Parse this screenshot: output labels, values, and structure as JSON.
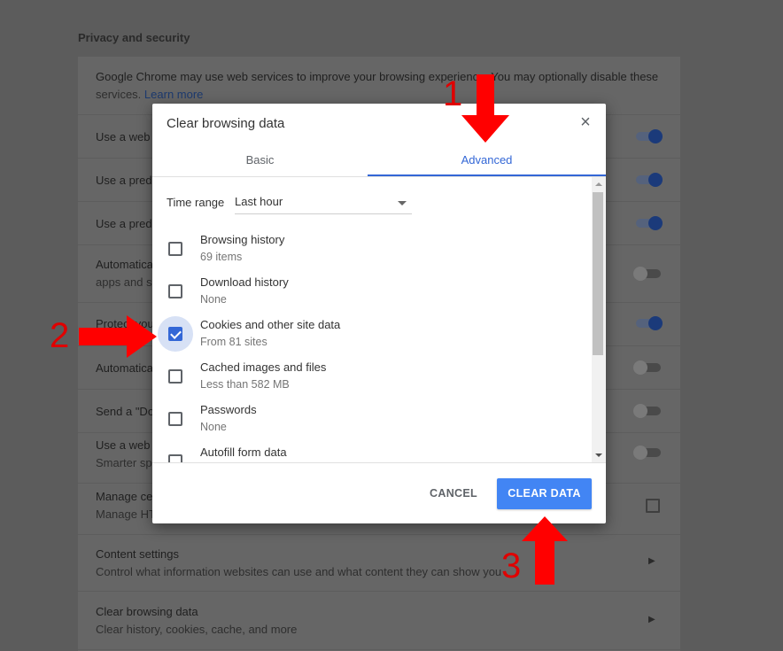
{
  "settings": {
    "section_title": "Privacy and security",
    "intro_text": "Google Chrome may use web services to improve your browsing experience. You may optionally disable these",
    "intro_text_2": "services.",
    "learn_more": "Learn more",
    "rows": [
      {
        "line1": "Use a web",
        "toggle": "on"
      },
      {
        "line1": "Use a predi",
        "toggle": "on"
      },
      {
        "line1": "Use a predi",
        "toggle": "on"
      },
      {
        "line1": "Automatica",
        "line2": "apps and s",
        "toggle": "off"
      },
      {
        "line1": "Protect you",
        "toggle": "on"
      },
      {
        "line1": "Automatica",
        "toggle": "off"
      },
      {
        "line1": "Send a \"Do",
        "toggle": "off"
      },
      {
        "line1": "Use a web",
        "line2": "Smarter sp",
        "toggle": "off"
      },
      {
        "line1": "Manage ce",
        "line2": "Manage HT"
      },
      {
        "line1": "Content settings",
        "line2": "Control what information websites can use and what content they can show you"
      },
      {
        "line1": "Clear browsing data",
        "line2": "Clear history, cookies, cache, and more"
      }
    ]
  },
  "dialog": {
    "title": "Clear browsing data",
    "tabs": [
      "Basic",
      "Advanced"
    ],
    "active_tab": "Advanced",
    "time_range_label": "Time range",
    "time_range_value": "Last hour",
    "items": [
      {
        "name": "Browsing history",
        "detail": "69 items",
        "checked": false
      },
      {
        "name": "Download history",
        "detail": "None",
        "checked": false
      },
      {
        "name": "Cookies and other site data",
        "detail": "From 81 sites",
        "checked": true
      },
      {
        "name": "Cached images and files",
        "detail": "Less than 582 MB",
        "checked": false
      },
      {
        "name": "Passwords",
        "detail": "None",
        "checked": false
      },
      {
        "name": "Autofill form data",
        "detail": "",
        "checked": false
      }
    ],
    "cancel_label": "CANCEL",
    "clear_label": "CLEAR DATA"
  },
  "annotations": {
    "step1": "1",
    "step2": "2",
    "step3": "3",
    "color": "#ff0000"
  },
  "colors": {
    "accent": "#3367d6",
    "button": "#4285f4"
  }
}
